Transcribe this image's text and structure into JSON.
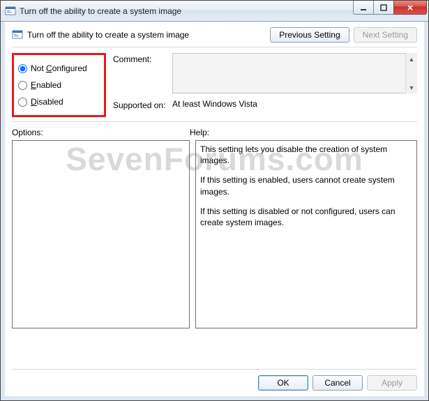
{
  "window": {
    "title": "Turn off the ability to create a system image"
  },
  "header": {
    "title": "Turn off the ability to create a system image",
    "prev_button": "Previous Setting",
    "next_button": "Next Setting"
  },
  "radios": {
    "not_configured": "Not Configured",
    "not_configured_ul": "C",
    "enabled": "Enabled",
    "enabled_ul": "E",
    "disabled": "Disabled",
    "disabled_ul": "D",
    "selected": "not_configured"
  },
  "fields": {
    "comment_label": "Comment:",
    "comment_value": "",
    "supported_label": "Supported on:",
    "supported_value": "At least Windows Vista"
  },
  "sections": {
    "options_label": "Options:",
    "help_label": "Help:"
  },
  "help_text": {
    "p1": "This setting lets you disable the creation of system images.",
    "p2": "If this setting is enabled, users cannot create system images.",
    "p3": "If this setting is disabled or not configured, users can create system images."
  },
  "footer": {
    "ok": "OK",
    "cancel": "Cancel",
    "apply": "Apply"
  },
  "watermark": "SevenForums.com"
}
